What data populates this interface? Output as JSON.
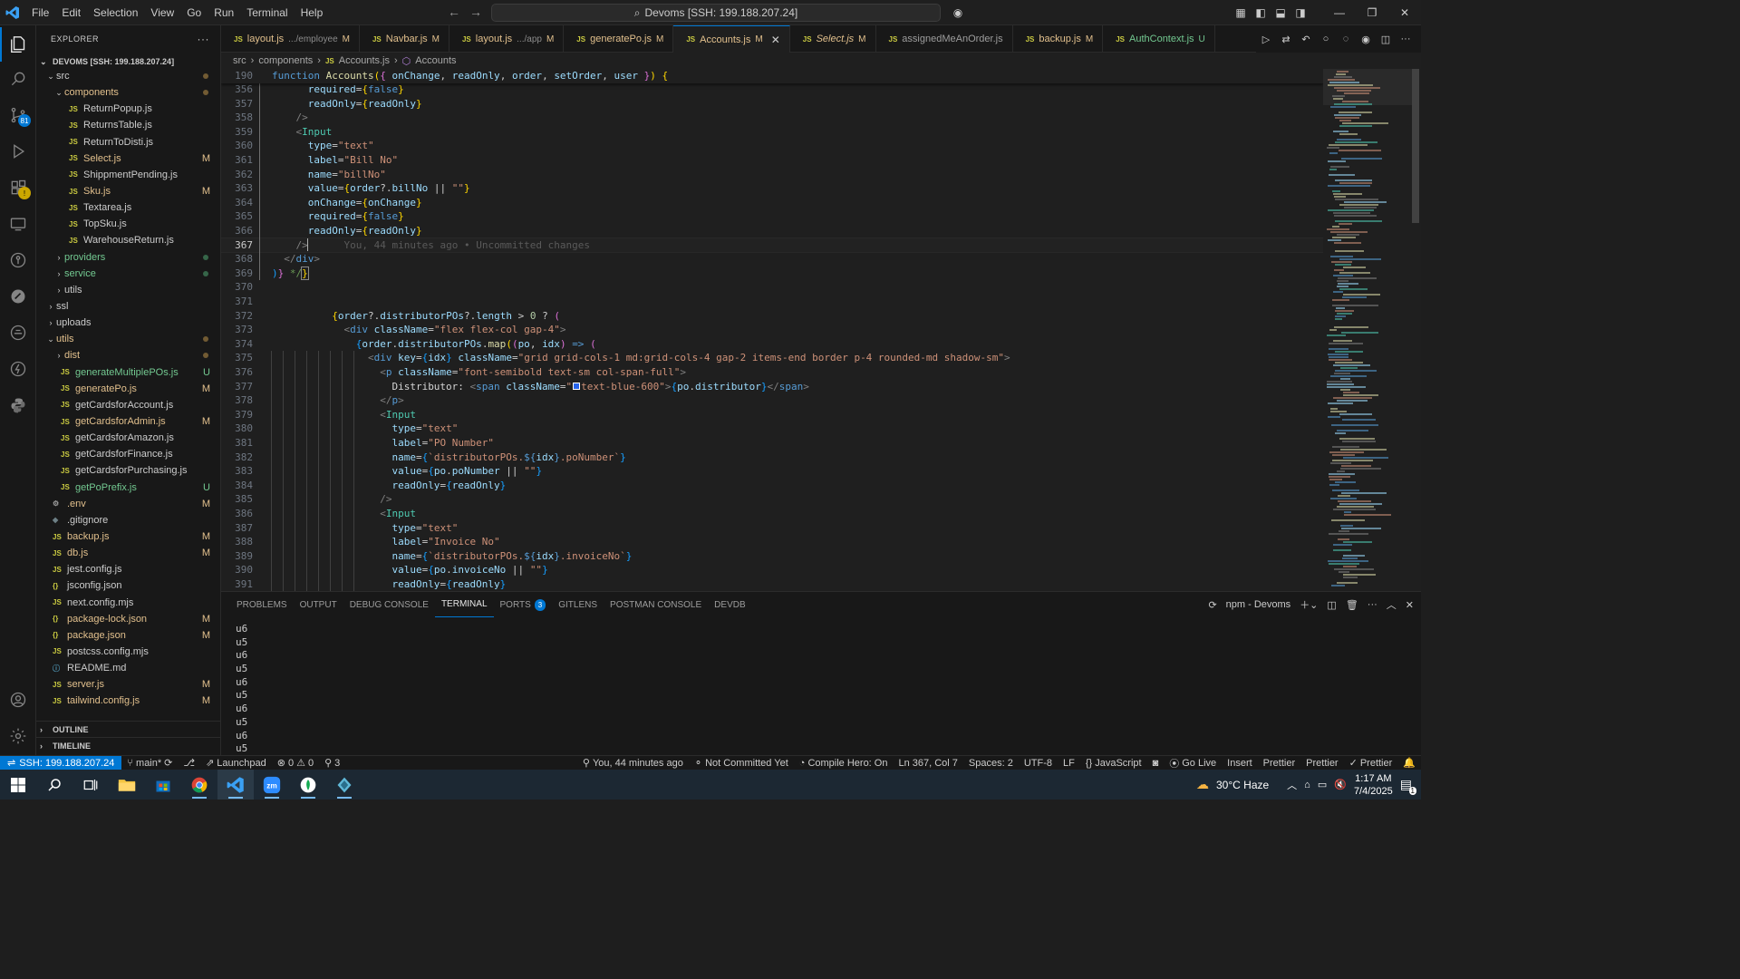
{
  "menu": [
    "File",
    "Edit",
    "Selection",
    "View",
    "Go",
    "Run",
    "Terminal",
    "Help"
  ],
  "search_text": "Devoms [SSH: 199.188.207.24]",
  "explorer": {
    "title": "EXPLORER",
    "root": "DEVOMS [SSH: 199.188.207.24]",
    "rows": [
      {
        "indent": 0,
        "kind": "folder-open",
        "name": "src",
        "dot": "mod"
      },
      {
        "indent": 1,
        "kind": "folder-open",
        "name": "components",
        "dot": "mod",
        "style": "folder-mod"
      },
      {
        "indent": 2,
        "kind": "js",
        "name": "ReturnPopup.js"
      },
      {
        "indent": 2,
        "kind": "js",
        "name": "ReturnsTable.js"
      },
      {
        "indent": 2,
        "kind": "js",
        "name": "ReturnToDisti.js"
      },
      {
        "indent": 2,
        "kind": "js",
        "name": "Select.js",
        "status": "M"
      },
      {
        "indent": 2,
        "kind": "js",
        "name": "ShippmentPending.js"
      },
      {
        "indent": 2,
        "kind": "js",
        "name": "Sku.js",
        "status": "M"
      },
      {
        "indent": 2,
        "kind": "js",
        "name": "Textarea.js"
      },
      {
        "indent": 2,
        "kind": "js",
        "name": "TopSku.js"
      },
      {
        "indent": 2,
        "kind": "js",
        "name": "WarehouseReturn.js"
      },
      {
        "indent": 1,
        "kind": "folder",
        "name": "providers",
        "dot": "green",
        "style": "untr"
      },
      {
        "indent": 1,
        "kind": "folder",
        "name": "service",
        "dot": "green",
        "style": "untr"
      },
      {
        "indent": 1,
        "kind": "folder",
        "name": "utils"
      },
      {
        "indent": 0,
        "kind": "folder",
        "name": "ssl"
      },
      {
        "indent": 0,
        "kind": "folder",
        "name": "uploads"
      },
      {
        "indent": 0,
        "kind": "folder-open",
        "name": "utils",
        "dot": "mod",
        "style": "folder-mod"
      },
      {
        "indent": 1,
        "kind": "folder",
        "name": "dist",
        "dot": "mod",
        "style": "folder-mod"
      },
      {
        "indent": 1,
        "kind": "js",
        "name": "generateMultiplePOs.js",
        "status": "U"
      },
      {
        "indent": 1,
        "kind": "js",
        "name": "generatePo.js",
        "status": "M"
      },
      {
        "indent": 1,
        "kind": "js",
        "name": "getCardsforAccount.js"
      },
      {
        "indent": 1,
        "kind": "js",
        "name": "getCardsforAdmin.js",
        "status": "M"
      },
      {
        "indent": 1,
        "kind": "js",
        "name": "getCardsforAmazon.js"
      },
      {
        "indent": 1,
        "kind": "js",
        "name": "getCardsforFinance.js"
      },
      {
        "indent": 1,
        "kind": "js",
        "name": "getCardsforPurchasing.js"
      },
      {
        "indent": 1,
        "kind": "js",
        "name": "getPoPrefix.js",
        "status": "U"
      },
      {
        "indent": 0,
        "kind": "gear",
        "name": ".env",
        "status": "M"
      },
      {
        "indent": 0,
        "kind": "git",
        "name": ".gitignore"
      },
      {
        "indent": 0,
        "kind": "js",
        "name": "backup.js",
        "status": "M"
      },
      {
        "indent": 0,
        "kind": "js",
        "name": "db.js",
        "status": "M"
      },
      {
        "indent": 0,
        "kind": "js",
        "name": "jest.config.js"
      },
      {
        "indent": 0,
        "kind": "json",
        "name": "jsconfig.json"
      },
      {
        "indent": 0,
        "kind": "js",
        "name": "next.config.mjs"
      },
      {
        "indent": 0,
        "kind": "json",
        "name": "package-lock.json",
        "status": "M"
      },
      {
        "indent": 0,
        "kind": "json",
        "name": "package.json",
        "status": "M"
      },
      {
        "indent": 0,
        "kind": "js",
        "name": "postcss.config.mjs"
      },
      {
        "indent": 0,
        "kind": "info",
        "name": "README.md"
      },
      {
        "indent": 0,
        "kind": "js",
        "name": "server.js",
        "status": "M"
      },
      {
        "indent": 0,
        "kind": "js",
        "name": "tailwind.config.js",
        "status": "M"
      }
    ],
    "outline": "OUTLINE",
    "timeline": "TIMELINE"
  },
  "tabs": [
    {
      "name": "layout.js",
      "desc": ".../employee",
      "status": "M"
    },
    {
      "name": "Navbar.js",
      "desc": "",
      "status": "M"
    },
    {
      "name": "layout.js",
      "desc": ".../app",
      "status": "M"
    },
    {
      "name": "generatePo.js",
      "desc": "",
      "status": "M"
    },
    {
      "name": "Accounts.js",
      "desc": "",
      "status": "M",
      "active": true
    },
    {
      "name": "Select.js",
      "desc": "",
      "status": "M"
    },
    {
      "name": "assignedMeAnOrder.js",
      "desc": "",
      "status": ""
    },
    {
      "name": "backup.js",
      "desc": "",
      "status": "M"
    },
    {
      "name": "AuthContext.js",
      "desc": "",
      "status": "U"
    }
  ],
  "breadcrumb": [
    "src",
    "components",
    "Accounts.js",
    "Accounts"
  ],
  "code": {
    "sticky": {
      "ln": "190",
      "html": "<span class=\"kw\">function</span> <span class=\"fn\">Accounts</span><span class=\"br3\">(</span><span class=\"br\">{</span> <span class=\"pm\">onChange</span>, <span class=\"pm\">readOnly</span>, <span class=\"pm\">order</span>, <span class=\"pm\">setOrder</span>, <span class=\"pm\">user</span> <span class=\"br\">}</span><span class=\"br3\">)</span> <span class=\"br3\">{</span>"
    },
    "lines": [
      {
        "ln": "356",
        "html": "      <span class=\"at\">required</span>=<span class=\"br3\">{</span><span class=\"kw\">false</span><span class=\"br3\">}</span>"
      },
      {
        "ln": "357",
        "html": "      <span class=\"at\">readOnly</span>=<span class=\"br3\">{</span><span class=\"pm\">readOnly</span><span class=\"br3\">}</span>"
      },
      {
        "ln": "358",
        "html": "    <span class=\"tg\">/&gt;</span>"
      },
      {
        "ln": "359",
        "html": "    <span class=\"tg\">&lt;</span><span class=\"tn\">Input</span>"
      },
      {
        "ln": "360",
        "html": "      <span class=\"at\">type</span>=<span class=\"st\">\"text\"</span>"
      },
      {
        "ln": "361",
        "html": "      <span class=\"at\">label</span>=<span class=\"st\">\"Bill No\"</span>"
      },
      {
        "ln": "362",
        "html": "      <span class=\"at\">name</span>=<span class=\"st\">\"billNo\"</span>"
      },
      {
        "ln": "363",
        "html": "      <span class=\"at\">value</span>=<span class=\"br3\">{</span><span class=\"pm\">order</span>?.<span class=\"pm\">billNo</span> || <span class=\"st\">\"\"</span><span class=\"br3\">}</span>"
      },
      {
        "ln": "364",
        "html": "      <span class=\"at\">onChange</span>=<span class=\"br3\">{</span><span class=\"pm\">onChange</span><span class=\"br3\">}</span>"
      },
      {
        "ln": "365",
        "html": "      <span class=\"at\">required</span>=<span class=\"br3\">{</span><span class=\"kw\">false</span><span class=\"br3\">}</span>"
      },
      {
        "ln": "366",
        "html": "      <span class=\"at\">readOnly</span>=<span class=\"br3\">{</span><span class=\"pm\">readOnly</span><span class=\"br3\">}</span>"
      },
      {
        "ln": "367",
        "cur": true,
        "html": "    <span class=\"tg\">/&gt;</span>      <span class=\"blame\">You, 44 minutes ago • Uncommitted changes</span>"
      },
      {
        "ln": "368",
        "html": "  <span class=\"tg\">&lt;/</span><span class=\"ht\">div</span><span class=\"tg\">&gt;</span>"
      },
      {
        "ln": "369",
        "html": "<span class=\"br2\">)</span><span class=\"br\">}</span> <span class=\"cm\">*/</span><span class=\"br3\" style=\"outline:1px solid #888\">}</span>"
      },
      {
        "ln": "370",
        "html": ""
      },
      {
        "ln": "371",
        "html": ""
      },
      {
        "ln": "372",
        "html": "          <span class=\"br3\">{</span><span class=\"pm\">order</span>?.<span class=\"pm\">distributorPOs</span>?.<span class=\"pm\">length</span> &gt; <span class=\"st\" style=\"color:#b5cea8\">0</span> ? <span class=\"br\">(</span>"
      },
      {
        "ln": "373",
        "html": "            <span class=\"tg\">&lt;</span><span class=\"ht\">div</span> <span class=\"at\">className</span>=<span class=\"st\">\"flex flex-col gap-4\"</span><span class=\"tg\">&gt;</span>"
      },
      {
        "ln": "374",
        "html": "              <span class=\"br2\">{</span><span class=\"pm\">order</span>.<span class=\"pm\">distributorPOs</span>.<span class=\"fn\">map</span><span class=\"br3\">(</span><span class=\"br\">(</span><span class=\"pm\">po</span>, <span class=\"pm\">idx</span><span class=\"br\">)</span> <span class=\"kw\">=&gt;</span> <span class=\"br\">(</span>"
      },
      {
        "ln": "375",
        "html": "                <span class=\"tg\">&lt;</span><span class=\"ht\">div</span> <span class=\"at\">key</span>=<span class=\"br2\">{</span><span class=\"pm\">idx</span><span class=\"br2\">}</span> <span class=\"at\">className</span>=<span class=\"st\">\"grid grid-cols-1 md:grid-cols-4 gap-2 items-end border p-4 rounded-md shadow-sm\"</span><span class=\"tg\">&gt;</span>"
      },
      {
        "ln": "376",
        "html": "                  <span class=\"tg\">&lt;</span><span class=\"ht\">p</span> <span class=\"at\">className</span>=<span class=\"st\">\"font-semibold text-sm col-span-full\"</span><span class=\"tg\">&gt;</span>"
      },
      {
        "ln": "377",
        "html": "                    <span class=\"pl\">Distributor: </span><span class=\"tg\">&lt;</span><span class=\"ht\">span</span> <span class=\"at\">className</span>=<span class=\"st\">\"</span><span class=\"color-swatch\"></span><span class=\"st\">text-blue-600\"</span><span class=\"tg\">&gt;</span><span class=\"br2\">{</span><span class=\"pm\">po</span>.<span class=\"pm\">distributor</span><span class=\"br2\">}</span><span class=\"tg\">&lt;/</span><span class=\"ht\">span</span><span class=\"tg\">&gt;</span>"
      },
      {
        "ln": "378",
        "html": "                  <span class=\"tg\">&lt;/</span><span class=\"ht\">p</span><span class=\"tg\">&gt;</span>"
      },
      {
        "ln": "379",
        "html": "                  <span class=\"tg\">&lt;</span><span class=\"tn\">Input</span>"
      },
      {
        "ln": "380",
        "html": "                    <span class=\"at\">type</span>=<span class=\"st\">\"text\"</span>"
      },
      {
        "ln": "381",
        "html": "                    <span class=\"at\">label</span>=<span class=\"st\">\"PO Number\"</span>"
      },
      {
        "ln": "382",
        "html": "                    <span class=\"at\">name</span>=<span class=\"br2\">{</span><span class=\"st\">`distributorPOs.</span><span class=\"kw\">${</span><span class=\"pm\">idx</span><span class=\"kw\">}</span><span class=\"st\">.poNumber`</span><span class=\"br2\">}</span>"
      },
      {
        "ln": "383",
        "html": "                    <span class=\"at\">value</span>=<span class=\"br2\">{</span><span class=\"pm\">po</span>.<span class=\"pm\">poNumber</span> || <span class=\"st\">\"\"</span><span class=\"br2\">}</span>"
      },
      {
        "ln": "384",
        "html": "                    <span class=\"at\">readOnly</span>=<span class=\"br2\">{</span><span class=\"pm\">readOnly</span><span class=\"br2\">}</span>"
      },
      {
        "ln": "385",
        "html": "                  <span class=\"tg\">/&gt;</span>"
      },
      {
        "ln": "386",
        "html": "                  <span class=\"tg\">&lt;</span><span class=\"tn\">Input</span>"
      },
      {
        "ln": "387",
        "html": "                    <span class=\"at\">type</span>=<span class=\"st\">\"text\"</span>"
      },
      {
        "ln": "388",
        "html": "                    <span class=\"at\">label</span>=<span class=\"st\">\"Invoice No\"</span>"
      },
      {
        "ln": "389",
        "html": "                    <span class=\"at\">name</span>=<span class=\"br2\">{</span><span class=\"st\">`distributorPOs.</span><span class=\"kw\">${</span><span class=\"pm\">idx</span><span class=\"kw\">}</span><span class=\"st\">.invoiceNo`</span><span class=\"br2\">}</span>"
      },
      {
        "ln": "390",
        "html": "                    <span class=\"at\">value</span>=<span class=\"br2\">{</span><span class=\"pm\">po</span>.<span class=\"pm\">invoiceNo</span> || <span class=\"st\">\"\"</span><span class=\"br2\">}</span>"
      },
      {
        "ln": "391",
        "html": "                    <span class=\"at\">readOnly</span>=<span class=\"br2\">{</span><span class=\"pm\">readOnly</span><span class=\"br2\">}</span>"
      }
    ]
  },
  "panel": {
    "tabs": [
      {
        "label": "PROBLEMS"
      },
      {
        "label": "OUTPUT"
      },
      {
        "label": "DEBUG CONSOLE"
      },
      {
        "label": "TERMINAL",
        "active": true
      },
      {
        "label": "PORTS",
        "badge": "3"
      },
      {
        "label": "GITLENS"
      },
      {
        "label": "POSTMAN CONSOLE"
      },
      {
        "label": "DEVDB"
      }
    ],
    "terminal_name": "npm - Devoms",
    "terminal_lines": [
      "u6",
      "u5",
      "u6",
      "u5",
      "u6",
      "u5",
      "u6",
      "u5",
      "u6",
      "u5"
    ]
  },
  "statusbar": {
    "remote": "SSH: 199.188.207.24",
    "branch": "main*",
    "launchpad": "Launchpad",
    "errors": "0",
    "warnings": "0",
    "ports": "3",
    "blame": "You, 44 minutes ago",
    "commit": "Not Committed Yet",
    "compile_hero": "Compile Hero: On",
    "position": "Ln 367, Col 7",
    "spaces": "Spaces: 2",
    "encoding": "UTF-8",
    "eol": "LF",
    "language": "JavaScript",
    "golive": "Go Live",
    "insert": "Insert",
    "prettier1": "Prettier",
    "prettier2": "Prettier",
    "prettier3": "Prettier"
  },
  "taskbar": {
    "weather": "30°C  Haze",
    "time": "1:17 AM",
    "date": "7/4/2025",
    "notifications": "1"
  },
  "colors": {
    "accent": "#0078d4",
    "modified": "#e2c08d",
    "untracked": "#73c991",
    "js_icon": "#cbcb41"
  }
}
